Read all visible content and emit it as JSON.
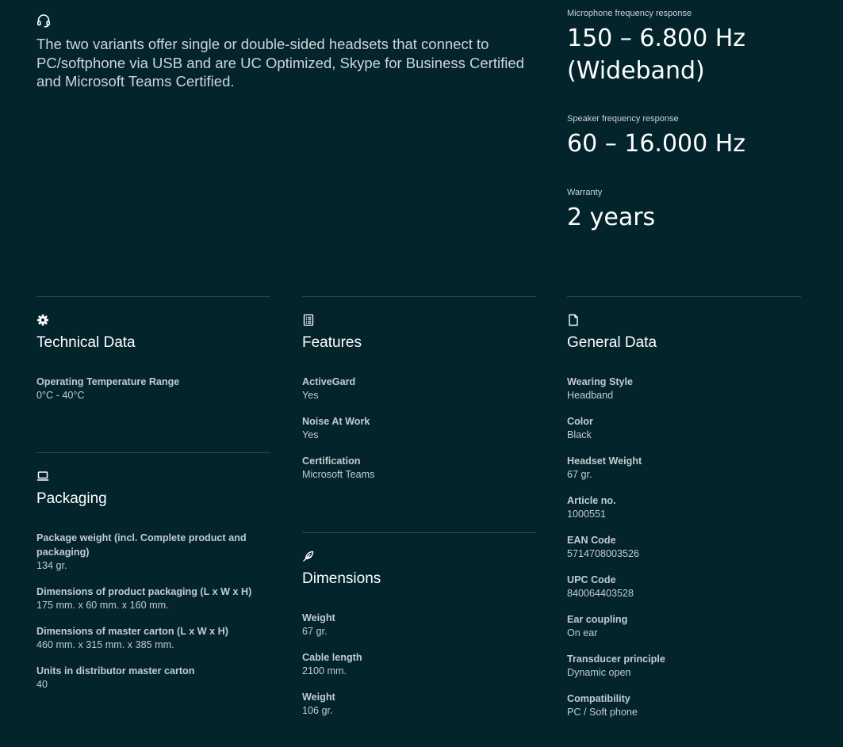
{
  "intro": {
    "text": "The two variants offer single or double-sided headsets that connect to PC/softphone via USB and are UC Optimized, Skype for Business Certified and Microsoft Teams Certified."
  },
  "stats": [
    {
      "label": "Microphone frequency response",
      "value": "150 – 6.800 Hz (Wideband)"
    },
    {
      "label": "Speaker frequency response",
      "value": "60 – 16.000 Hz"
    },
    {
      "label": "Warranty",
      "value": "2 years"
    }
  ],
  "technical": {
    "title": "Technical Data",
    "items": [
      {
        "label": "Operating Temperature Range",
        "value": "0°C - 40°C"
      }
    ]
  },
  "packaging": {
    "title": "Packaging",
    "items": [
      {
        "label": "Package weight (incl. Complete product and packaging)",
        "value": "134 gr."
      },
      {
        "label": "Dimensions of product packaging (L x W x H)",
        "value": "175 mm. x 60 mm. x 160 mm."
      },
      {
        "label": "Dimensions of master carton (L x W x H)",
        "value": "460 mm. x 315 mm. x 385 mm."
      },
      {
        "label": "Units in distributor master carton",
        "value": "40"
      }
    ]
  },
  "features": {
    "title": "Features",
    "items": [
      {
        "label": "ActiveGard",
        "value": "Yes"
      },
      {
        "label": "Noise At Work",
        "value": "Yes"
      },
      {
        "label": "Certification",
        "value": "Microsoft Teams"
      }
    ]
  },
  "dimensions": {
    "title": "Dimensions",
    "items": [
      {
        "label": "Weight",
        "value": "67 gr."
      },
      {
        "label": "Cable length",
        "value": "2100 mm."
      },
      {
        "label": "Weight",
        "value": "106 gr."
      }
    ]
  },
  "general": {
    "title": "General Data",
    "items": [
      {
        "label": "Wearing Style",
        "value": "Headband"
      },
      {
        "label": "Color",
        "value": "Black"
      },
      {
        "label": "Headset Weight",
        "value": "67 gr."
      },
      {
        "label": "Article no.",
        "value": "1000551"
      },
      {
        "label": "EAN Code",
        "value": "5714708003526"
      },
      {
        "label": "UPC Code",
        "value": "840064403528"
      },
      {
        "label": "Ear coupling",
        "value": "On ear"
      },
      {
        "label": "Transducer principle",
        "value": "Dynamic open"
      },
      {
        "label": "Compatibility",
        "value": "PC / Soft phone"
      }
    ]
  },
  "icons": {
    "intro": "headset-icon",
    "technical": "gear-icon",
    "packaging": "laptop-icon",
    "features": "checklist-icon",
    "dimensions": "feather-icon",
    "general": "document-icon"
  }
}
